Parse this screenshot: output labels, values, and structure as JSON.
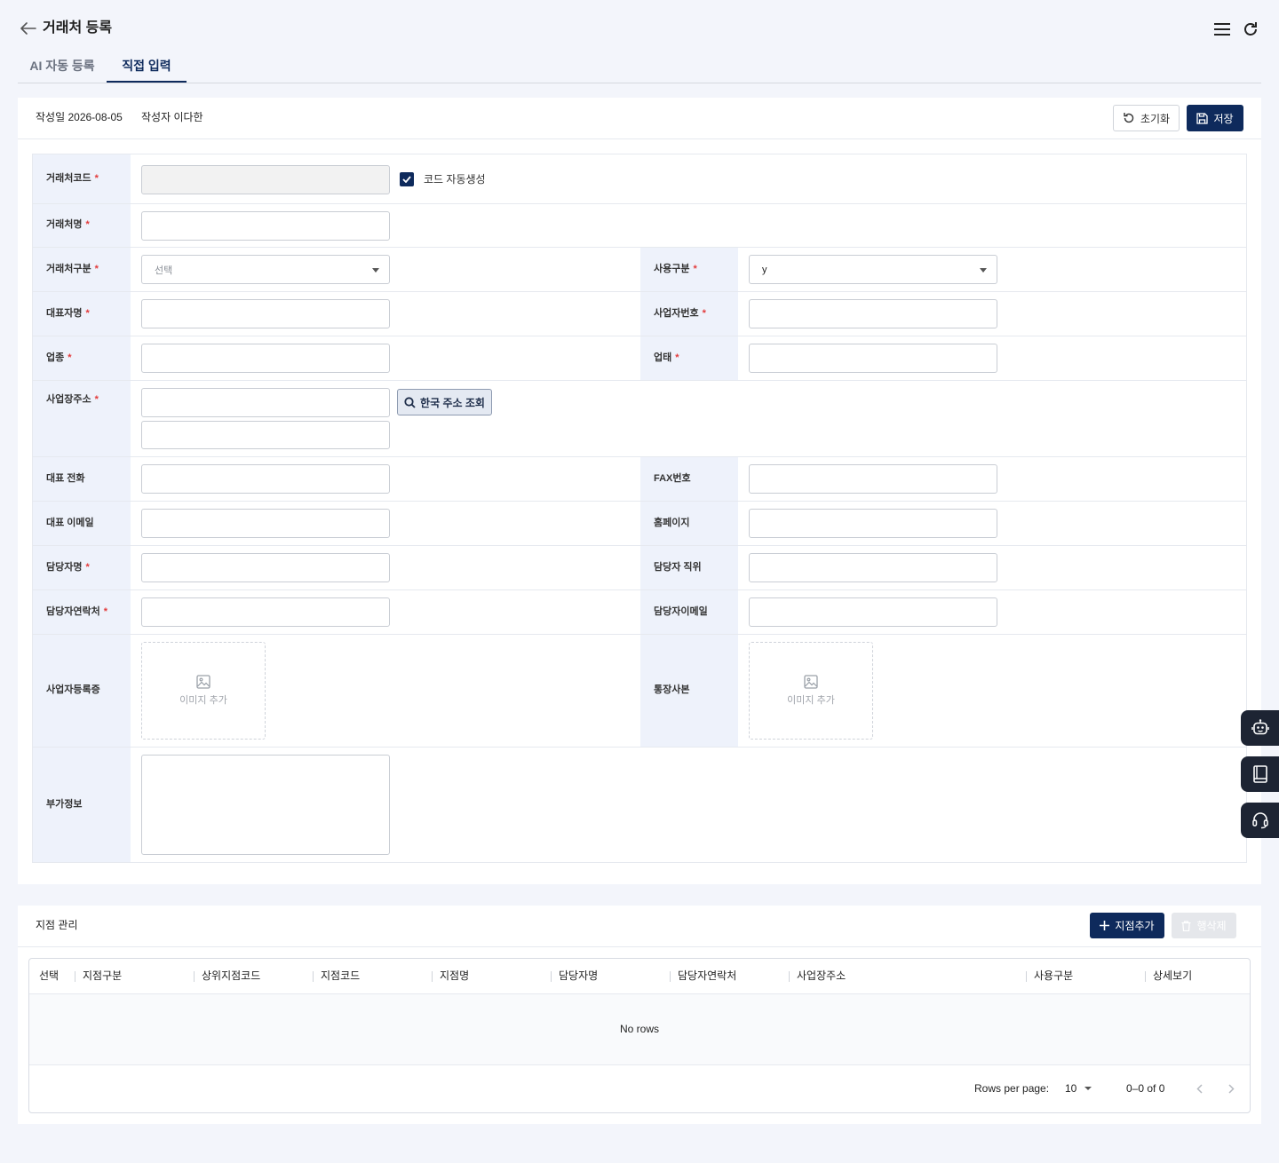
{
  "header": {
    "title": "거래처 등록"
  },
  "tabs": [
    {
      "label": "AI 자동 등록"
    },
    {
      "label": "직접 입력"
    }
  ],
  "meta": {
    "created_label": "작성일",
    "created_date": "2026-08-05",
    "author_label": "작성자",
    "author_name": "이다한"
  },
  "actions": {
    "reset": "초기화",
    "save": "저장"
  },
  "form": {
    "code_label": "거래처코드",
    "auto_code_label": "코드 자동생성",
    "name_label": "거래처명",
    "type_label": "거래처구분",
    "type_placeholder": "선택",
    "usage_label": "사용구분",
    "usage_value": "y",
    "ceo_label": "대표자명",
    "bizno_label": "사업자번호",
    "industry_label": "업종",
    "biztype_label": "업태",
    "address_label": "사업장주소",
    "address_search": "한국 주소 조회",
    "phone_label": "대표 전화",
    "fax_label": "FAX번호",
    "email_label": "대표 이메일",
    "homepage_label": "홈페이지",
    "manager_label": "담당자명",
    "manager_title_label": "담당자 직위",
    "manager_phone_label": "담당자연락처",
    "manager_email_label": "담당자이메일",
    "bizcert_label": "사업자등록증",
    "bankbook_label": "통장사본",
    "image_add": "이미지 추가",
    "extra_label": "부가정보",
    "required_mark": "*"
  },
  "branch": {
    "title": "지점 관리",
    "add": "지점추가",
    "delete": "행삭제",
    "columns": [
      "선택",
      "지점구분",
      "상위지점코드",
      "지점코드",
      "지점명",
      "담당자명",
      "담당자연락처",
      "사업장주소",
      "사용구분",
      "상세보기"
    ],
    "empty": "No rows",
    "rows_per_page_label": "Rows per page:",
    "rows_per_page": "10",
    "range": "0–0 of 0"
  },
  "colors": {
    "primary": "#0e2a5c",
    "label_bg": "#eef2fb",
    "required": "#e23a3a",
    "page_bg": "#f3f5fb"
  }
}
